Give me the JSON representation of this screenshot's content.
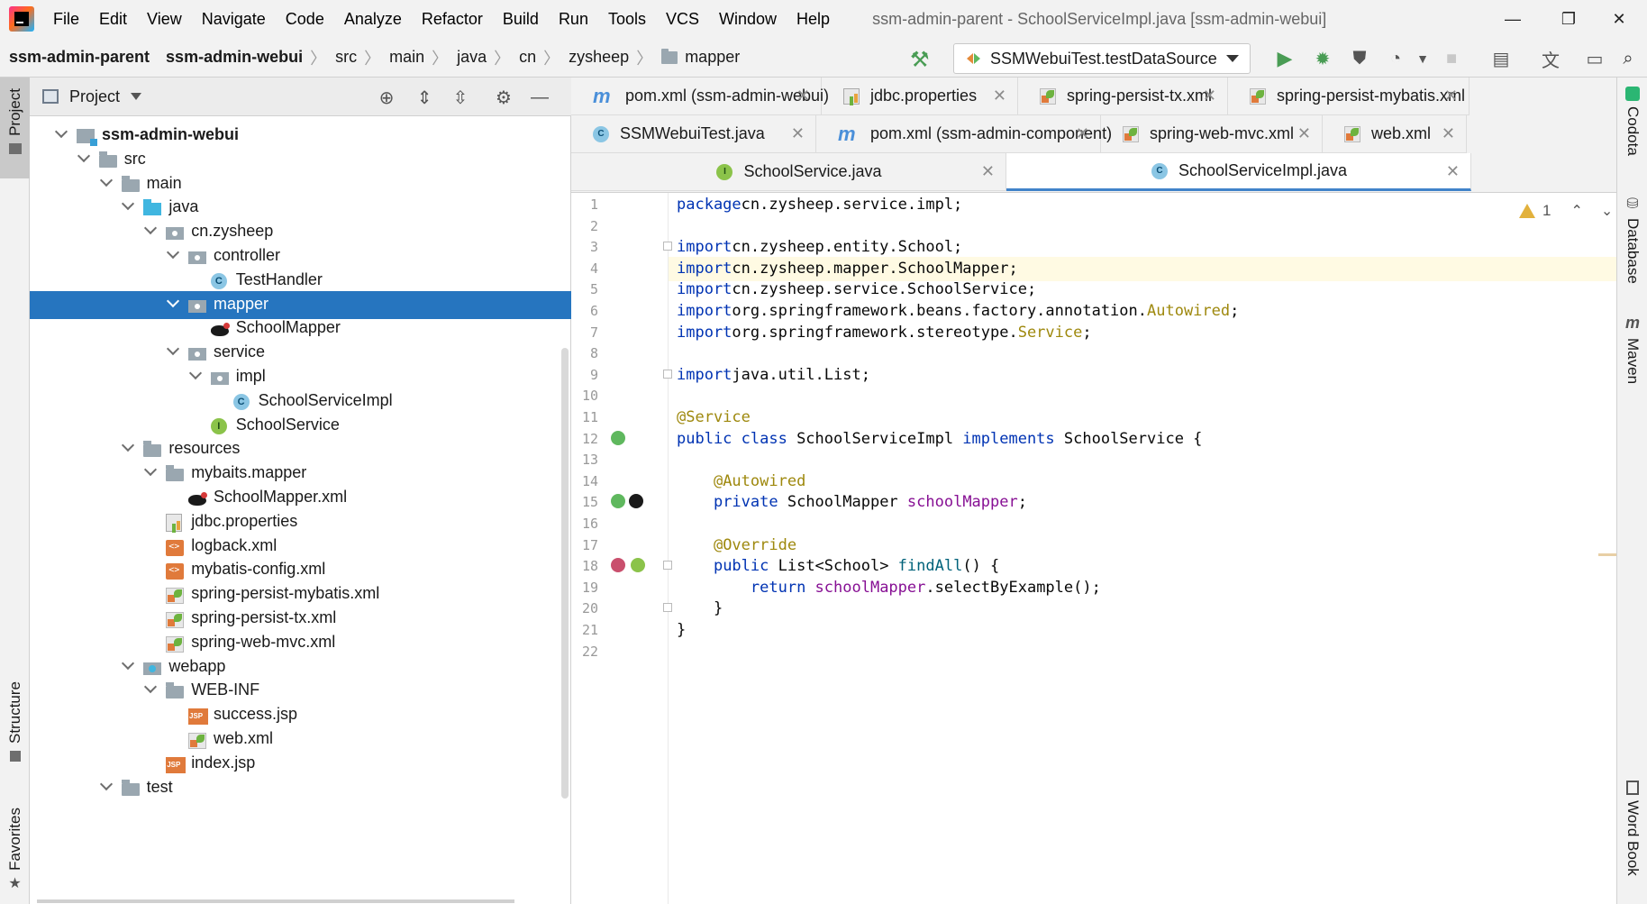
{
  "menubar": {
    "items": [
      "File",
      "Edit",
      "View",
      "Navigate",
      "Code",
      "Analyze",
      "Refactor",
      "Build",
      "Run",
      "Tools",
      "VCS",
      "Window",
      "Help"
    ],
    "window_title": "ssm-admin-parent - SchoolServiceImpl.java [ssm-admin-webui]",
    "controls": {
      "minimize": "—",
      "restore": "❐",
      "close": "✕"
    }
  },
  "breadcrumb": [
    "ssm-admin-parent",
    "ssm-admin-webui",
    "src",
    "main",
    "java",
    "cn",
    "zysheep",
    "mapper"
  ],
  "toolbar": {
    "run_config": "SSMWebuiTest.testDataSource"
  },
  "left_strip": {
    "project": "Project",
    "structure": "Structure",
    "favorites": "Favorites"
  },
  "right_strip": {
    "codota": "Codota",
    "database": "Database",
    "maven": "Maven",
    "wordbook": "Word Book"
  },
  "project_panel": {
    "title": "Project",
    "tree": [
      {
        "label": "ssm-admin-webui",
        "icon": "module",
        "level": 1,
        "expanded": true,
        "bold": true
      },
      {
        "label": "src",
        "icon": "folder",
        "level": 2,
        "expanded": true
      },
      {
        "label": "main",
        "icon": "folder",
        "level": 3,
        "expanded": true
      },
      {
        "label": "java",
        "icon": "folder-blue",
        "level": 4,
        "expanded": true
      },
      {
        "label": "cn.zysheep",
        "icon": "pkg",
        "level": 5,
        "expanded": true
      },
      {
        "label": "controller",
        "icon": "pkg",
        "level": 6,
        "expanded": true
      },
      {
        "label": "TestHandler",
        "icon": "cls",
        "level": 7
      },
      {
        "label": "mapper",
        "icon": "pkg",
        "level": 6,
        "expanded": true,
        "selected": true
      },
      {
        "label": "SchoolMapper",
        "icon": "bird",
        "level": 7
      },
      {
        "label": "service",
        "icon": "pkg",
        "level": 6,
        "expanded": true
      },
      {
        "label": "impl",
        "icon": "pkg",
        "level": 7,
        "expanded": true
      },
      {
        "label": "SchoolServiceImpl",
        "icon": "cls",
        "level": 8
      },
      {
        "label": "SchoolService",
        "icon": "intf",
        "level": 7
      },
      {
        "label": "resources",
        "icon": "folder",
        "level": 4,
        "expanded": true
      },
      {
        "label": "mybaits.mapper",
        "icon": "folder",
        "level": 5,
        "expanded": true
      },
      {
        "label": "SchoolMapper.xml",
        "icon": "bird",
        "level": 6
      },
      {
        "label": "jdbc.properties",
        "icon": "props",
        "level": 5
      },
      {
        "label": "logback.xml",
        "icon": "xml",
        "level": 5
      },
      {
        "label": "mybatis-config.xml",
        "icon": "xml",
        "level": 5
      },
      {
        "label": "spring-persist-mybatis.xml",
        "icon": "spring",
        "level": 5
      },
      {
        "label": "spring-persist-tx.xml",
        "icon": "spring",
        "level": 5
      },
      {
        "label": "spring-web-mvc.xml",
        "icon": "spring",
        "level": 5
      },
      {
        "label": "webapp",
        "icon": "webapp",
        "level": 4,
        "expanded": true
      },
      {
        "label": "WEB-INF",
        "icon": "folder",
        "level": 5,
        "expanded": true
      },
      {
        "label": "success.jsp",
        "icon": "jsp",
        "level": 6
      },
      {
        "label": "web.xml",
        "icon": "spring",
        "level": 6
      },
      {
        "label": "index.jsp",
        "icon": "jsp",
        "level": 5
      },
      {
        "label": "test",
        "icon": "folder",
        "level": 3,
        "expanded": true
      }
    ]
  },
  "tabs": [
    {
      "label": "pom.xml (ssm-admin-webui)",
      "icon": "m"
    },
    {
      "label": "jdbc.properties",
      "icon": "props"
    },
    {
      "label": "spring-persist-tx.xml",
      "icon": "spring"
    },
    {
      "label": "spring-persist-mybatis.xml",
      "icon": "spring"
    },
    {
      "label": "SSMWebuiTest.java",
      "icon": "cls"
    },
    {
      "label": "pom.xml (ssm-admin-component)",
      "icon": "m"
    },
    {
      "label": "spring-web-mvc.xml",
      "icon": "spring"
    },
    {
      "label": "web.xml",
      "icon": "spring"
    },
    {
      "label": "SchoolService.java",
      "icon": "intf"
    },
    {
      "label": "SchoolServiceImpl.java",
      "icon": "cls",
      "active": true
    }
  ],
  "editor": {
    "warning_count": "1",
    "lines": [
      [
        [
          "kw",
          "package"
        ],
        [
          "",
          "cn.zysheep.service.impl;"
        ]
      ],
      [],
      [
        [
          "kw",
          "import"
        ],
        [
          "",
          "cn.zysheep.entity.School;"
        ]
      ],
      [
        [
          "kw",
          "import"
        ],
        [
          "",
          "cn.zysheep.mapper.SchoolMapper;"
        ]
      ],
      [
        [
          "kw",
          "import"
        ],
        [
          "",
          "cn.zysheep.service.SchoolService;"
        ]
      ],
      [
        [
          "kw",
          "import"
        ],
        [
          "",
          "org.springframework.beans.factory.annotation."
        ],
        [
          "ann",
          "Autowired"
        ],
        [
          "",
          "; "
        ]
      ],
      [
        [
          "kw",
          "import"
        ],
        [
          "",
          "org.springframework.stereotype."
        ],
        [
          "ann",
          "Service"
        ],
        [
          "",
          ";"
        ]
      ],
      [],
      [
        [
          "kw",
          "import"
        ],
        [
          "",
          "java.util.List;"
        ]
      ],
      [],
      [
        [
          "ann",
          "@Service"
        ]
      ],
      [
        [
          "kw",
          "public class"
        ],
        [
          "",
          " SchoolServiceImpl "
        ],
        [
          "kw",
          "implements"
        ],
        [
          "",
          " SchoolService {"
        ]
      ],
      [],
      [
        [
          "",
          "    "
        ],
        [
          "ann",
          "@Autowired"
        ]
      ],
      [
        [
          "",
          "    "
        ],
        [
          "kw",
          "private"
        ],
        [
          "",
          " SchoolMapper "
        ],
        [
          "fld",
          "schoolMapper"
        ],
        [
          "",
          ";"
        ]
      ],
      [],
      [
        [
          "",
          "    "
        ],
        [
          "ann",
          "@Override"
        ]
      ],
      [
        [
          "",
          "    "
        ],
        [
          "kw",
          "public"
        ],
        [
          "",
          " List<School> "
        ],
        [
          "mth",
          "findAll"
        ],
        [
          "",
          "() {"
        ]
      ],
      [
        [
          "",
          "        "
        ],
        [
          "kw",
          "return"
        ],
        [
          "",
          ""
        ],
        [
          "fld",
          " schoolMapper"
        ],
        [
          "",
          ".selectByExample();"
        ]
      ],
      [
        [
          "",
          "    }"
        ]
      ],
      [
        [
          "",
          "}"
        ]
      ],
      []
    ]
  },
  "colors": {
    "selection": "#2675bf",
    "keyword": "#0033b3",
    "annotation": "#9e880d",
    "field": "#871094",
    "method": "#00627a"
  }
}
